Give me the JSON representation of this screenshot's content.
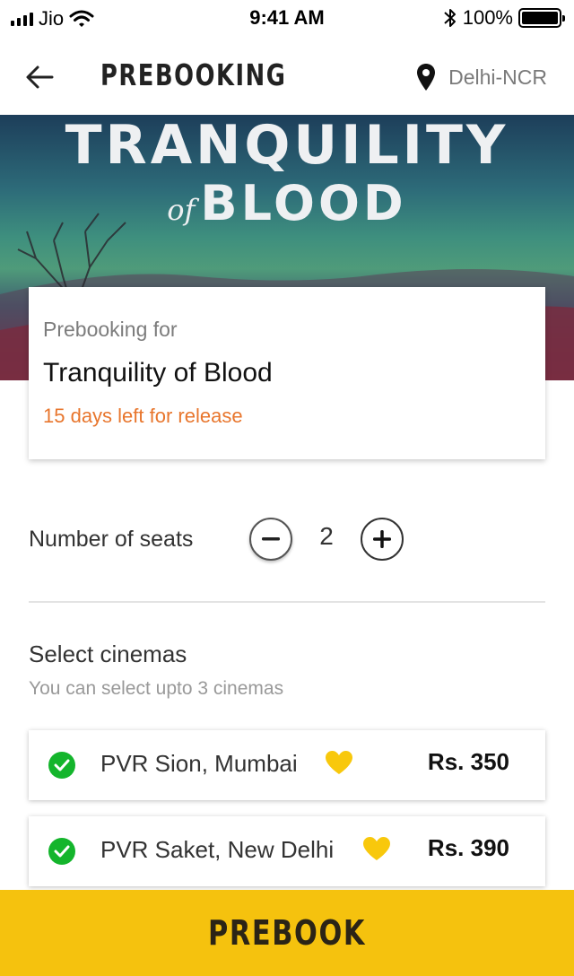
{
  "status_bar": {
    "carrier": "Jio",
    "time": "9:41 AM",
    "battery": "100%",
    "battery_level": 1.0
  },
  "header": {
    "title": "PREBOOKING",
    "location": "Delhi-NCR"
  },
  "banner": {
    "line1": "TRANQUILITY",
    "line2_small": "of",
    "line2": "BLOOD"
  },
  "movie_card": {
    "label": "Prebooking for",
    "movie": "Tranquility of Blood",
    "release": "15 days left for release"
  },
  "seats": {
    "label": "Number of seats",
    "value": "2"
  },
  "cinemas": {
    "heading": "Select cinemas",
    "subtitle": "You can select upto 3 cinemas",
    "items": [
      {
        "name": "PVR Sion, Mumbai",
        "price": "Rs. 350",
        "selected": true,
        "favorite": true
      },
      {
        "name": "PVR Saket, New Delhi",
        "price": "Rs. 390",
        "selected": true,
        "favorite": true
      }
    ]
  },
  "cta": {
    "label": "PREBOOK"
  },
  "colors": {
    "accent": "#f5c20e",
    "release": "#e8762d",
    "check": "#14b52c",
    "heart": "#f8c80c"
  },
  "icons": {
    "back": "back-arrow-icon",
    "location": "location-pin-icon",
    "minus": "minus-icon",
    "plus": "plus-icon",
    "check": "check-circle-icon",
    "heart": "heart-icon"
  }
}
